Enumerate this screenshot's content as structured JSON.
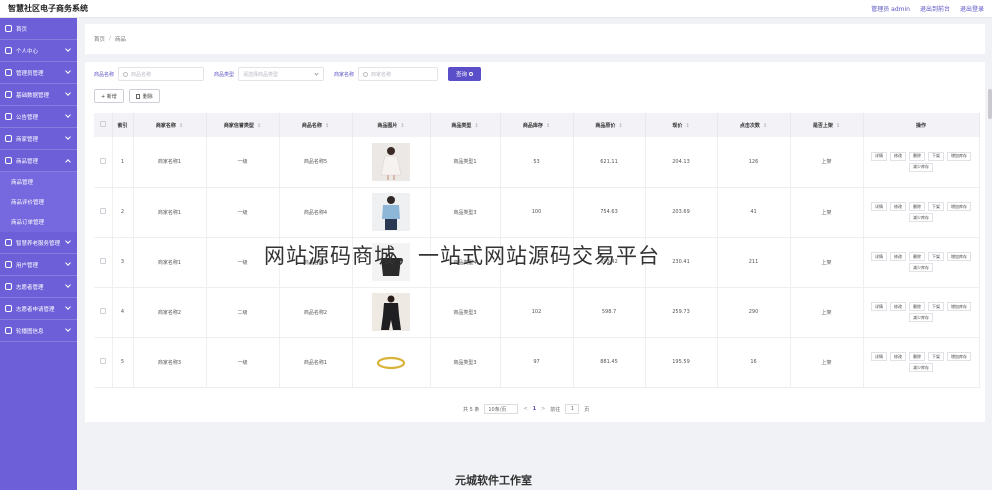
{
  "app": {
    "title": "智慧社区电子商务系统"
  },
  "top_links": {
    "admin": "管理员 admin",
    "exit_front": "退出到前台",
    "logout": "退出登录"
  },
  "sidebar": {
    "items": [
      {
        "label": "首页",
        "expandable": false
      },
      {
        "label": "个人中心",
        "expandable": true
      },
      {
        "label": "管理员管理",
        "expandable": true
      },
      {
        "label": "基础数据管理",
        "expandable": true
      },
      {
        "label": "公告管理",
        "expandable": true
      },
      {
        "label": "商家管理",
        "expandable": true
      },
      {
        "label": "商品管理",
        "expandable": true,
        "open": true,
        "children": [
          "商品管理",
          "商品评价管理",
          "商品订单管理"
        ]
      },
      {
        "label": "智慧养老服务管理",
        "expandable": true
      },
      {
        "label": "用户管理",
        "expandable": true
      },
      {
        "label": "志愿者管理",
        "expandable": true
      },
      {
        "label": "志愿者申请管理",
        "expandable": true
      },
      {
        "label": "轮播图信息",
        "expandable": true
      }
    ]
  },
  "breadcrumb": {
    "home": "首页",
    "separator": "/",
    "current": "商品"
  },
  "search": {
    "name_label": "商品名称",
    "name_placeholder": "商品名称",
    "type_label": "商品类型",
    "type_placeholder": "请选择商品类型",
    "merchant_label": "商家名称",
    "merchant_placeholder": "商家名称",
    "button": "查询"
  },
  "actions": {
    "add": "+ 新增",
    "delete": "删除"
  },
  "table": {
    "headers": [
      "索引",
      "商家名称",
      "商家信誉类型",
      "商品名称",
      "商品图片",
      "商品类型",
      "商品库存",
      "商品原价",
      "现价",
      "点击次数",
      "是否上架",
      "操作"
    ],
    "rows": [
      {
        "index": "1",
        "merchant": "商家名称1",
        "credit": "一级",
        "name": "商品名称5",
        "image": "dress",
        "type": "商品类型1",
        "stock": "53",
        "price": "621.11",
        "now": "204.13",
        "clicks": "126",
        "status": "上架"
      },
      {
        "index": "2",
        "merchant": "商家名称1",
        "credit": "一级",
        "name": "商品名称4",
        "image": "shirt",
        "type": "商品类型3",
        "stock": "100",
        "price": "754.63",
        "now": "203.69",
        "clicks": "41",
        "status": "上架"
      },
      {
        "index": "3",
        "merchant": "商家名称1",
        "credit": "一级",
        "name": "商品名称3",
        "image": "bag",
        "type": "商品类型4",
        "stock": "87",
        "price": "693.42",
        "now": "230.41",
        "clicks": "211",
        "status": "上架"
      },
      {
        "index": "4",
        "merchant": "商家名称2",
        "credit": "二级",
        "name": "商品名称2",
        "image": "suit",
        "type": "商品类型3",
        "stock": "102",
        "price": "598.7",
        "now": "259.73",
        "clicks": "290",
        "status": "上架"
      },
      {
        "index": "5",
        "merchant": "商家名称3",
        "credit": "一级",
        "name": "商品名称1",
        "image": "bracelet",
        "type": "商品类型3",
        "stock": "97",
        "price": "881.45",
        "now": "195.59",
        "clicks": "16",
        "status": "上架"
      }
    ],
    "ops": [
      "详情",
      "修改",
      "删除",
      "下架",
      "增加库存",
      "减少库存"
    ]
  },
  "pager": {
    "total": "共 5 条",
    "page_size": "10条/页",
    "prev": "<",
    "page": "1",
    "next": ">",
    "goto_prefix": "前往",
    "goto_value": "1",
    "goto_suffix": "页"
  },
  "overlay": {
    "watermark": "网站源码商城，一站式网站源码交易平台",
    "signature": "元城软件工作室"
  },
  "colors": {
    "sidebar": "#6d5fd8",
    "accent": "#5a4fc8",
    "background": "#f1f2f6"
  }
}
